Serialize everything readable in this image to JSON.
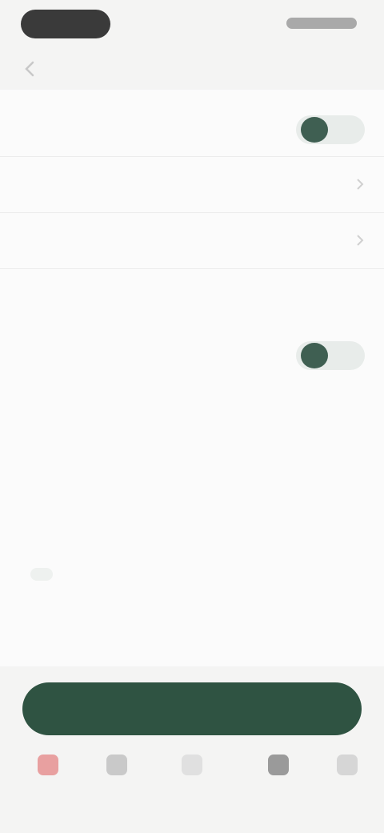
{
  "status_bar": {},
  "nav": {
    "title": "",
    "back_icon": "back-arrow-icon"
  },
  "settings": [
    {
      "label": "",
      "type": "toggle",
      "checked": true
    },
    {
      "label": "",
      "type": "select",
      "value": ""
    },
    {
      "label": "",
      "sub": "",
      "type": "select",
      "value": ""
    }
  ],
  "section": {
    "heading": ""
  },
  "notify": {
    "label": "",
    "type": "toggle",
    "checked": true
  },
  "description": {
    "title": "",
    "muted": "",
    "text": ""
  },
  "tags": {
    "label": "",
    "muted": "",
    "chip": ""
  },
  "primary_button": {
    "label": ""
  },
  "tab_bar": {
    "tabs": [
      {
        "icon": "home-icon",
        "label": "",
        "color": "#e8a0a0"
      },
      {
        "icon": "list-icon",
        "label": "",
        "color": "#c9c9c9"
      },
      {
        "icon": "add-icon",
        "label": "",
        "color": "#e0e0e0"
      },
      {
        "icon": "chat-icon",
        "label": "",
        "color": "#9a9a9a"
      },
      {
        "icon": "profile-icon",
        "label": "",
        "color": "#d6d6d6"
      }
    ]
  },
  "colors": {
    "accent": "#2f5342",
    "toggle_knob": "#3f5f52",
    "background": "#f4f4f3"
  }
}
